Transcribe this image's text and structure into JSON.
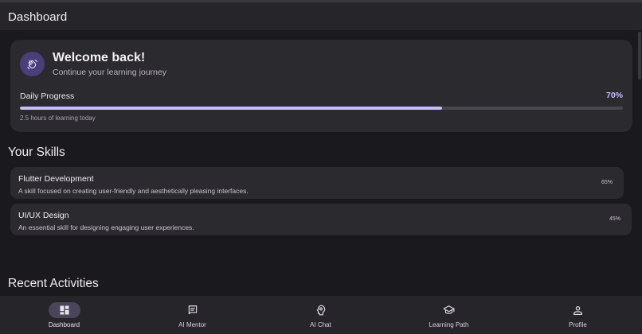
{
  "app": {
    "title": "Dashboard"
  },
  "welcome": {
    "title": "Welcome back!",
    "subtitle": "Continue your learning journey",
    "progress_label": "Daily Progress",
    "progress_percent_text": "70%",
    "progress_value": 0.7,
    "note": "2.5 hours of learning today",
    "icon": "waving-hands-icon"
  },
  "skills": {
    "title": "Your Skills",
    "items": [
      {
        "name": "Flutter Development",
        "description": "A skill focused on creating user-friendly and aesthetically pleasing interfaces.",
        "percent": "65%"
      },
      {
        "name": "UI/UX Design",
        "description": "An essential skill for designing engaging user experiences.",
        "percent": "45%"
      }
    ]
  },
  "activities": {
    "title": "Recent Activities"
  },
  "nav": {
    "items": [
      {
        "label": "Dashboard",
        "icon": "dashboard-icon",
        "active": true
      },
      {
        "label": "AI Mentor",
        "icon": "chat-bubble-icon",
        "active": false
      },
      {
        "label": "AI Chat",
        "icon": "psychology-icon",
        "active": false
      },
      {
        "label": "Learning Path",
        "icon": "graduation-cap-icon",
        "active": false
      },
      {
        "label": "Profile",
        "icon": "person-icon",
        "active": false
      }
    ]
  },
  "colors": {
    "background": "#1a191d",
    "card": "#2b2a2f",
    "accent": "#c7befa",
    "avatar": "#4a3f78",
    "nav_active_pill": "#4a4558"
  }
}
